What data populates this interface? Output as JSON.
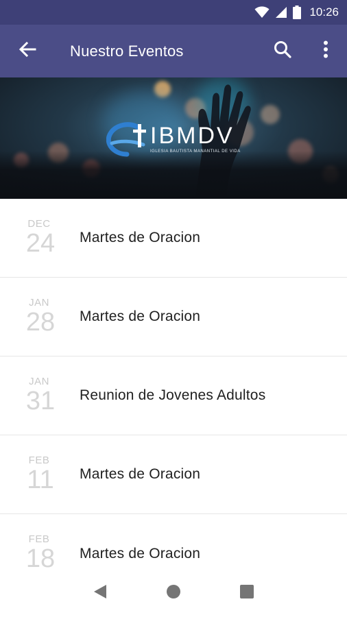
{
  "status_bar": {
    "time": "10:26",
    "icons": [
      "wifi-icon",
      "signal-icon",
      "battery-icon"
    ]
  },
  "app_bar": {
    "title": "Nuestro Eventos",
    "back_icon": "arrow-left-icon",
    "actions": [
      "search-icon",
      "more-vert-icon"
    ],
    "color": "#4b4d87",
    "status_color": "#3e4077"
  },
  "banner": {
    "logo_text": "IBMDV",
    "logo_subtitle": "IGLESIA BAUTISTA MANANTIAL DE VIDA"
  },
  "events": [
    {
      "month": "DEC",
      "day": "24",
      "title": "Martes de Oracion"
    },
    {
      "month": "JAN",
      "day": "28",
      "title": "Martes de Oracion"
    },
    {
      "month": "JAN",
      "day": "31",
      "title": "Reunion de Jovenes Adultos"
    },
    {
      "month": "FEB",
      "day": "11",
      "title": "Martes de Oracion"
    },
    {
      "month": "FEB",
      "day": "18",
      "title": "Martes de Oracion"
    }
  ],
  "nav_bar": {
    "buttons": [
      "back-triangle-icon",
      "home-circle-icon",
      "recents-square-icon"
    ]
  }
}
